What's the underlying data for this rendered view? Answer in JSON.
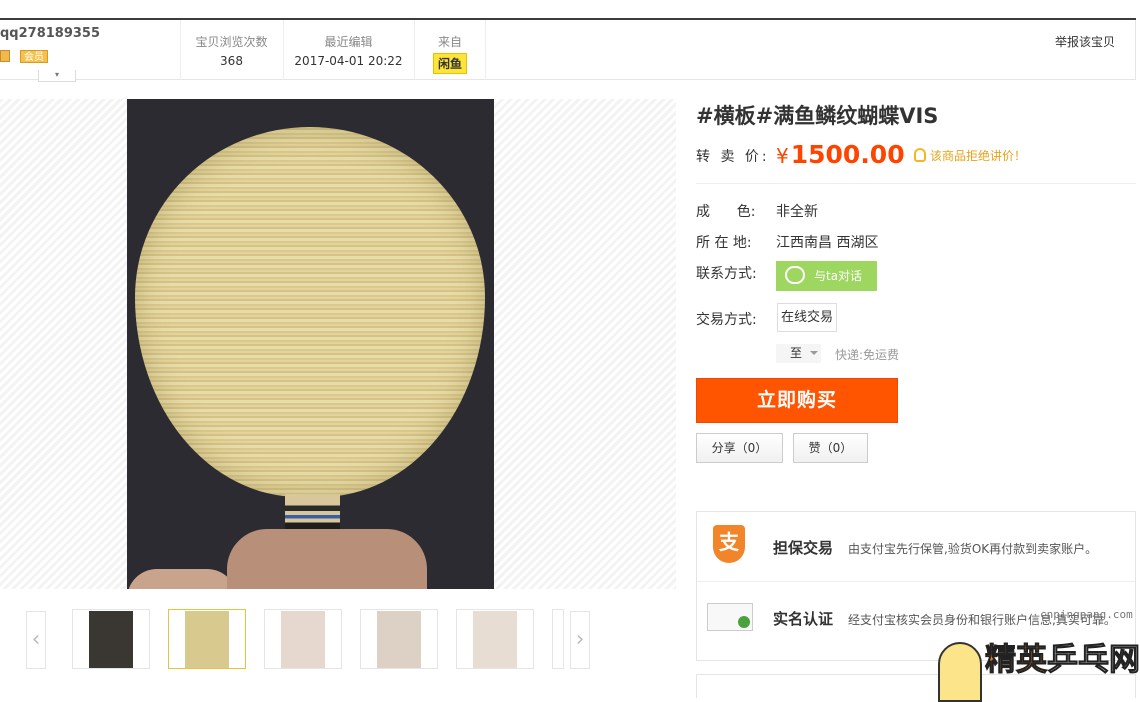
{
  "seller": {
    "name": "qq278189355",
    "member_badge": "会员",
    "dropdown": "▾"
  },
  "stats": {
    "views_label": "宝贝浏览次数",
    "views_value": "368",
    "edited_label": "最近编辑",
    "edited_value": "2017-04-01 20:22",
    "source_label": "来自",
    "source_value": "闲鱼"
  },
  "report_link": "举报该宝贝",
  "product": {
    "title": "#横板#满鱼鳞纹蝴蝶VIS",
    "price_label": "转 卖 价:",
    "currency": "¥",
    "price": "1500.00",
    "bargain_note": "该商品拒绝讲价！",
    "condition_label": "成      色:",
    "condition_value": "非全新",
    "location_label": "所 在 地:",
    "location_value": "江西南昌 西湖区",
    "contact_label": "联系方式:",
    "chat_button": "与ta对话",
    "trade_label": "交易方式:",
    "trade_value": "在线交易",
    "ship_to": "至",
    "shipping": "快递:免运费"
  },
  "actions": {
    "buy": "立即购买",
    "share": "分享（0）",
    "like": "赞（0）"
  },
  "gallery": {
    "prev_arrow": "‹",
    "next_arrow": "›",
    "thumb_count": 5,
    "active_thumb": 2
  },
  "guarantee": {
    "row1_icon": "支",
    "row1_title": "担保交易",
    "row1_desc": "由支付宝先行保管,验货OK再付款到卖家账户。",
    "row2_title": "实名认证",
    "row2_desc": "经支付宝核实会员身份和银行账户信息,真实可靠。"
  },
  "watermark": {
    "url": "cnpingpang.com",
    "text_part1": "精英",
    "text_part2": "乒乓网"
  },
  "colors": {
    "accent_orange": "#ff5400",
    "price_red": "#ff4400",
    "chat_green": "#9ed760",
    "xianyu_yellow": "#fde43a"
  }
}
